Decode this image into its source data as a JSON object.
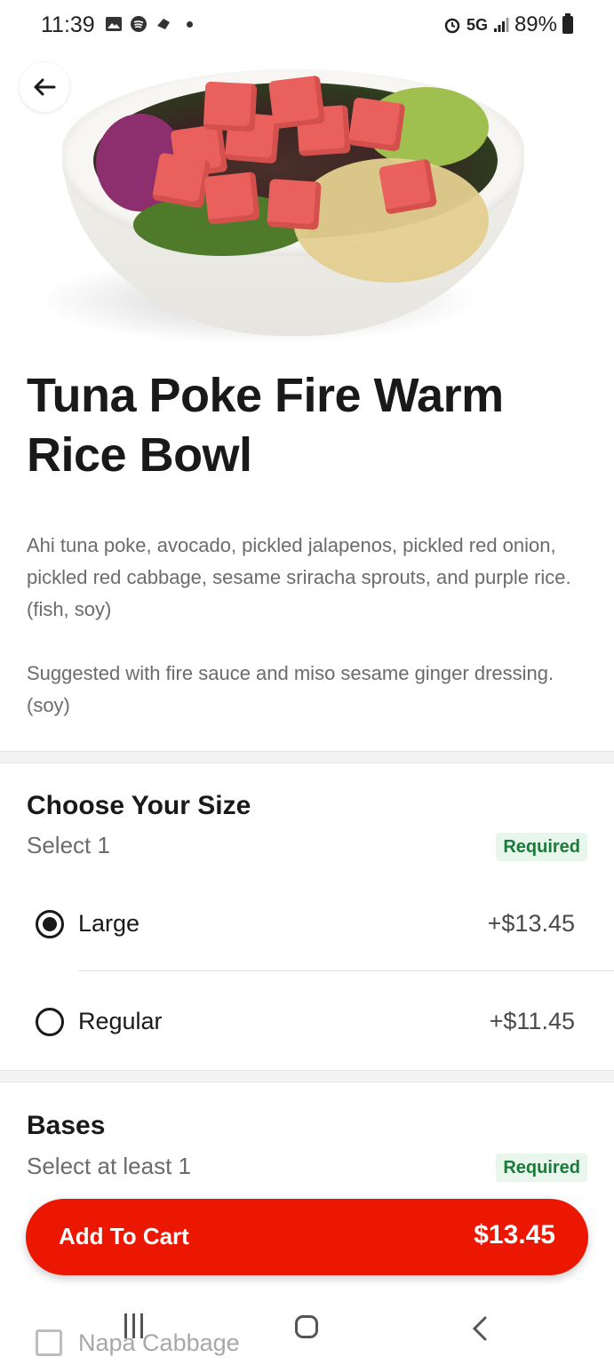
{
  "status_bar": {
    "time": "11:39",
    "network": "5G",
    "battery": "89%"
  },
  "product": {
    "title": "Tuna Poke Fire Warm Rice Bowl",
    "description": [
      "Ahi tuna poke, avocado, pickled jalapenos, pickled red onion, pickled red cabbage, sesame sriracha sprouts, and purple rice. (fish, soy)",
      "Suggested with fire sauce and miso sesame ginger dressing. (soy)"
    ]
  },
  "size_section": {
    "title": "Choose Your Size",
    "subtitle": "Select 1",
    "badge": "Required",
    "options": [
      {
        "label": "Large",
        "price": "+$13.45",
        "selected": true
      },
      {
        "label": "Regular",
        "price": "+$11.45",
        "selected": false
      }
    ]
  },
  "bases_section": {
    "title": "Bases",
    "subtitle": "Select at least 1",
    "badge": "Required",
    "options": [
      {
        "label": "Napa Cabbage",
        "checked": false
      }
    ]
  },
  "cart_button": {
    "label": "Add To Cart",
    "price": "$13.45"
  },
  "colors": {
    "brand_red": "#eb1700",
    "required_green": "#1a7a3a"
  },
  "icons": {
    "back": "arrow-left-icon",
    "nav_recents": "recent-apps-icon",
    "nav_home": "home-icon",
    "nav_back": "chevron-left-icon"
  }
}
